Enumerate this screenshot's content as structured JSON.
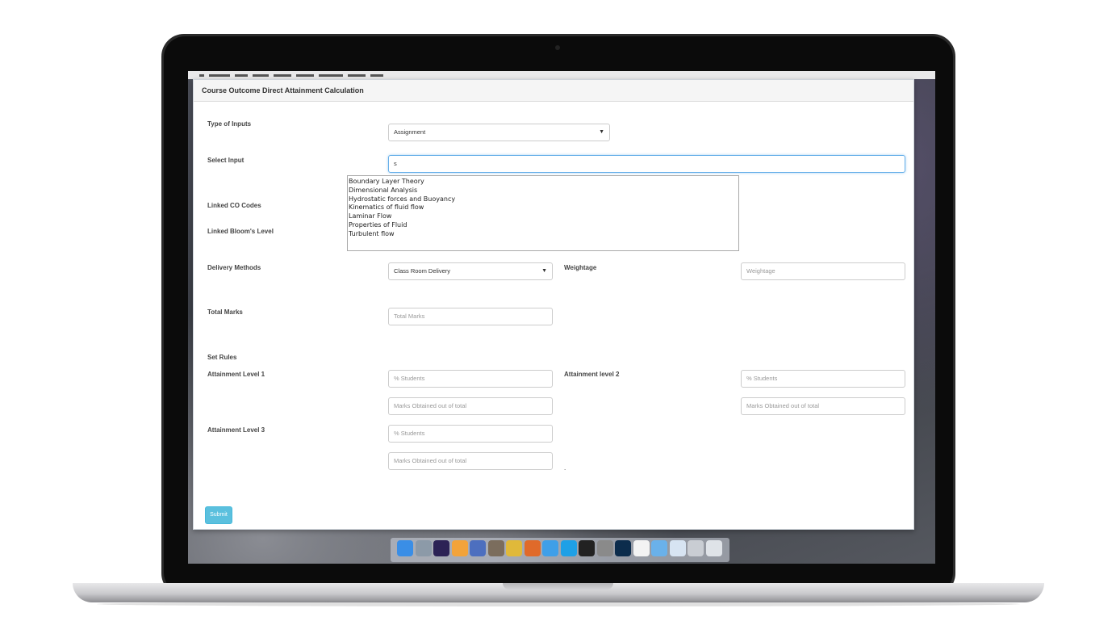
{
  "window": {
    "title": "Course Outcome Direct Attainment Calculation"
  },
  "form": {
    "type_of_inputs_label": "Type of Inputs",
    "type_of_inputs_value": "Assignment",
    "select_input_label": "Select Input",
    "select_input_value": "s",
    "autocomplete_options": [
      "Boundary Layer Theory",
      "Dimensional Analysis",
      "Hydrostatic forces and Buoyancy",
      "Kinematics of fluid flow",
      "Laminar Flow",
      "Properties of Fluid",
      "Turbulent flow"
    ],
    "linked_co_label": "Linked CO Codes",
    "linked_bloom_label": "Linked Bloom's Level",
    "delivery_methods_label": "Delivery Methods",
    "delivery_methods_value": "Class Room Delivery",
    "weightage_label": "Weightage",
    "weightage_placeholder": "Weightage",
    "total_marks_label": "Total Marks",
    "total_marks_placeholder": "Total Marks",
    "set_rules_label": "Set Rules",
    "level1_label": "Attainment Level 1",
    "level2_label": "Attainment level 2",
    "level3_label": "Attainment Level 3",
    "students_placeholder": "% Students",
    "marks_placeholder": "Marks Obtained out of total",
    "dot_text": ".",
    "submit_label": "Submit"
  },
  "dock": {
    "icons": [
      {
        "name": "finder-icon",
        "color": "#3a8ee6"
      },
      {
        "name": "launchpad-icon",
        "color": "#8c9aa8"
      },
      {
        "name": "eclipse-icon",
        "color": "#2c2255"
      },
      {
        "name": "sublime-icon",
        "color": "#f2a33a"
      },
      {
        "name": "network-icon",
        "color": "#4d6fbf"
      },
      {
        "name": "gimp-icon",
        "color": "#7b6d5d"
      },
      {
        "name": "chrome-icon",
        "color": "#e0b93a"
      },
      {
        "name": "firefox-icon",
        "color": "#e06a2a"
      },
      {
        "name": "safari-icon",
        "color": "#3f9fe8"
      },
      {
        "name": "skype-icon",
        "color": "#1ea0e6"
      },
      {
        "name": "terminal-icon",
        "color": "#222222"
      },
      {
        "name": "system-preferences-icon",
        "color": "#8a8a8a"
      },
      {
        "name": "photoshop-icon",
        "color": "#0c2c4c"
      },
      {
        "name": "document-icon",
        "color": "#f3f3f3"
      },
      {
        "name": "folder-icon",
        "color": "#6ab1ea"
      },
      {
        "name": "downloads-icon",
        "color": "#d7e4f2"
      },
      {
        "name": "screen-icon",
        "color": "#c9cdd3"
      },
      {
        "name": "trash-icon",
        "color": "#dfe3e8"
      }
    ]
  }
}
